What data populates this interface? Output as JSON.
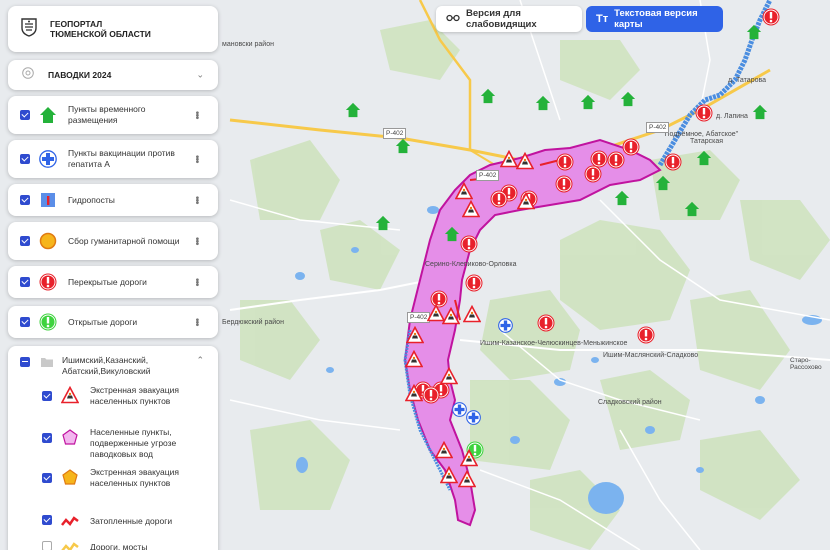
{
  "top_bar": {
    "low_vision_label": "Версия для слабовидящих",
    "text_version_label": "Текстовая версия карты"
  },
  "logo": {
    "line1": "ГЕОПОРТАЛ",
    "line2": "ТЮМЕНСКОЙ ОБЛАСТИ"
  },
  "theme": {
    "label": "ПАВОДКИ 2024"
  },
  "layers": [
    {
      "label": "Пункты временного размещения",
      "checked": true,
      "icon": "house-icon"
    },
    {
      "label": "Пункты вакцинации против гепатита А",
      "checked": true,
      "icon": "medical-cross-icon"
    },
    {
      "label": "Гидропосты",
      "checked": true,
      "icon": "gauge-icon"
    },
    {
      "label": "Сбор гуманитарной помощи",
      "checked": true,
      "icon": "circle-orange-icon"
    },
    {
      "label": "Перекрытые дороги",
      "checked": true,
      "icon": "exclamation-red-icon"
    },
    {
      "label": "Открытые дороги",
      "checked": true,
      "icon": "exclamation-green-icon"
    }
  ],
  "group": {
    "label": "Ишимский,Казанский, Абатский,Викуловский",
    "items": [
      {
        "label": "Экстренная эвакуация населенных пунктов",
        "checked": true,
        "icon": "warning-triangle-icon"
      },
      {
        "label": "Населенные пункты, подверженные угрозе паводковых вод",
        "checked": true,
        "icon": "pink-pentagon-icon"
      },
      {
        "label": "Экстренная эвакуация населенных пунктов",
        "checked": true,
        "icon": "orange-pentagon-icon"
      },
      {
        "label": "Затопленные дороги",
        "checked": true,
        "icon": "red-road-icon"
      },
      {
        "label": "Дороги, мосты",
        "checked": false,
        "icon": "yellow-road-icon"
      }
    ]
  },
  "map_labels": {
    "district_top": "мановски район",
    "tatarova": "д. Татарова",
    "lapina": "д. Лапина",
    "podyemnoe": "\"Подъёмное, Абатское\"",
    "tatarskaya": "Татарская",
    "klepikovo": "Серино-Клепиково-Орловка",
    "berdyuzhsky": "Бердюжский район",
    "ishim_kazan": "Ишим-Казанское-Челюскинцев-Меньжинское",
    "ishim_maslyansky": "Ишим-Маслянский-Сладково",
    "sladkovsky": "Сладковский район",
    "staro_rassohovo": "Старо-\nРассохово",
    "road_p402_a": "Р-402",
    "road_p402_b": "Р-402",
    "road_p402_c": "Р-402",
    "road_p402_d": "Р-402"
  },
  "colors": {
    "accent": "#2f63e7",
    "checkbox": "#2f4bcf",
    "flood_zone": "#e58ee8",
    "flood_border": "#c0139f",
    "water": "#7bb3ef",
    "forest": "#cfe3bf",
    "road_major": "#f7c94a",
    "closed_road": "#e8212b",
    "open_road": "#3ed33e",
    "shelter": "#24b23a"
  }
}
